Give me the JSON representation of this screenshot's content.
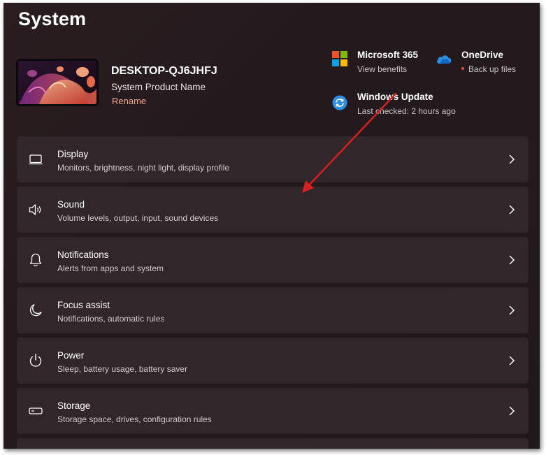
{
  "page": {
    "title": "System"
  },
  "device": {
    "name": "DESKTOP-QJ6JHFJ",
    "model": "System Product Name",
    "rename_label": "Rename"
  },
  "tiles": [
    {
      "title": "Microsoft 365",
      "subtitle": "View benefits",
      "icon": "microsoft-logo-icon"
    },
    {
      "title": "OneDrive",
      "subtitle": "Back up files",
      "icon": "onedrive-cloud-icon",
      "status_color": "#e34f3a"
    },
    {
      "title": "Windows Update",
      "subtitle": "Last checked: 2 hours ago",
      "icon": "windows-update-icon"
    }
  ],
  "settings": [
    {
      "title": "Display",
      "subtitle": "Monitors, brightness, night light, display profile",
      "icon": "display-icon"
    },
    {
      "title": "Sound",
      "subtitle": "Volume levels, output, input, sound devices",
      "icon": "speaker-icon"
    },
    {
      "title": "Notifications",
      "subtitle": "Alerts from apps and system",
      "icon": "bell-icon"
    },
    {
      "title": "Focus assist",
      "subtitle": "Notifications, automatic rules",
      "icon": "moon-icon"
    },
    {
      "title": "Power",
      "subtitle": "Sleep, battery usage, battery saver",
      "icon": "power-icon"
    },
    {
      "title": "Storage",
      "subtitle": "Storage space, drives, configuration rules",
      "icon": "storage-drive-icon"
    }
  ],
  "colors": {
    "accent_link": "#f0a58a",
    "annotation_arrow": "#d42020",
    "card_background": "#31262a"
  }
}
